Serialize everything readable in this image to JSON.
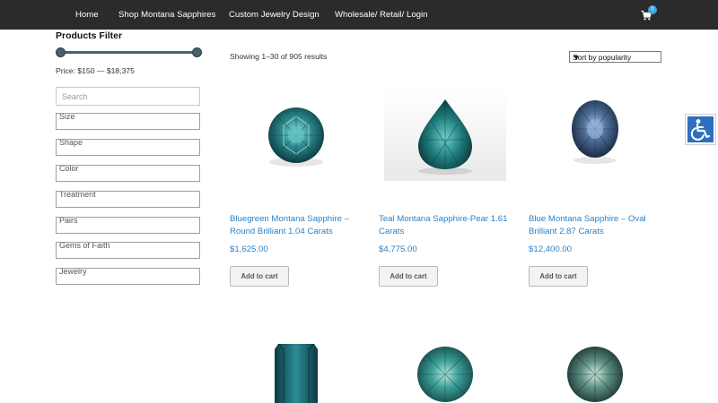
{
  "nav": {
    "home": "Home",
    "shop": "Shop Montana Sapphires",
    "custom": "Custom Jewelry Design",
    "wholesale": "Wholesale/ Retail/ Login",
    "cart_count": "0"
  },
  "sidebar": {
    "title": "Products Filter",
    "price_text": "Price: $150 — $18,375",
    "search_placeholder": "Search",
    "filters": [
      {
        "label": "Size"
      },
      {
        "label": "Shape"
      },
      {
        "label": "Color"
      },
      {
        "label": "Treatment"
      },
      {
        "label": "Pairs"
      },
      {
        "label": "Gems of Faith"
      },
      {
        "label": "Jewelry"
      }
    ]
  },
  "results": {
    "count": "Showing 1–30 of 905 results",
    "sort": "Sort by popularity"
  },
  "add_to_cart_label": "Add to cart",
  "products": [
    {
      "title_line1": "Bluegreen Montana Sapphire –",
      "title_line2": "Round Brilliant 1.04 Carats",
      "price": "$1,625.00"
    },
    {
      "title_line1": "Teal Montana Sapphire-Pear 1.61",
      "title_line2": "Carats",
      "price": "$4,775.00"
    },
    {
      "title_line1": "Blue Montana Sapphire – Oval",
      "title_line2": "Brilliant 2.87 Carats",
      "price": "$12,400.00"
    }
  ],
  "colors": {
    "nav_bg": "#2b2b2b",
    "link": "#2c81c5",
    "slider": "#49616f",
    "accessibility": "#2f6fbd"
  }
}
